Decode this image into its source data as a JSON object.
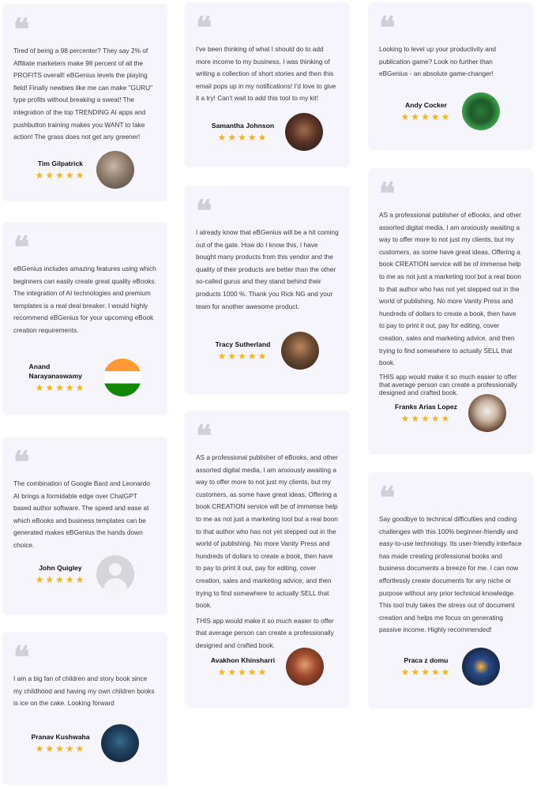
{
  "testimonials": [
    {
      "text": [
        "Tired of being a 98 percenter? They say 2% of Affiliate marketers make 98 percent of all the PROFITS overall! eBGenius levels the playing field! Finally newbies like me can make \"GURU\" type profits without breaking a sweat! The integration of the top TRENDING AI apps and pushbutton training makes you WANT to take action! The grass does not get any greener!"
      ],
      "name": "Tim Gilpatrick",
      "stars": "★★★★★"
    },
    {
      "text": [
        "eBGenius includes amazing features using which beginners can easily create great quality eBooks. The integration of AI technologies and premium templates is a real deal breaker. I would highly recommend eBGenius for your upcoming eBook creation requirements."
      ],
      "name": "Anand Narayanaswamy",
      "stars": "★★★★★"
    },
    {
      "text": [
        "The combination of Google Bard and Leonardo AI brings a formidable edge over ChatGPT based author software. The speed and ease at which eBooks and business templates can be generated makes eBGenius the hands down choice."
      ],
      "name": "John Quigley",
      "stars": "★★★★★"
    },
    {
      "text": [
        "I am a big fan of children and story book since my childhood and having my own children books is ice on the cake. Looking forward"
      ],
      "name": "Pranav Kushwaha",
      "stars": "★★★★★"
    },
    {
      "text": [
        "I've been thinking of what I should do to add more income to my business. I was thinking of writing a collection of short stories and then this email pops up in my notifications! I'd love to give it a try! Can't wait to add this tool to my kit!"
      ],
      "name": "Samantha Johnson",
      "stars": "★★★★★"
    },
    {
      "text": [
        "I already know that eBGenius will be a hit coming out of the gate. How do I know this, I have bought many products from this vendor and the quality of their products are better than the other so-called gurus and they stand behind their products 1000 %. Thank you Rick NG and your team for another awesome product."
      ],
      "name": "Tracy Sutherland",
      "stars": "★★★★★"
    },
    {
      "text": [
        "AS a professional publisher of eBooks, and other assorted digital media, I am anxiously awaiting a way to offer more to not just my clients, but my customers, as some have great ideas, Offering a book CREATION service will be of immense help to me as not just a marketing tool but a real boon to that author who has not yet stepped out in the world of publishing. No more Vanity Press and hundreds of dollars to create a book, then have to pay to print it out, pay for editing, cover creation, sales and marketing advice, and then trying to find somewhere to actually SELL that book.",
        "THIS app would make it so much easier to offer that average person can create a professionally designed and crafted book."
      ],
      "name": "Avakhon Khinsharri",
      "stars": "★★★★★"
    },
    {
      "text": [
        "Looking to level up your productivity and publication game? Look no further than eBGenius - an absolute game-changer!"
      ],
      "name": "Andy Cocker",
      "stars": "★★★★★"
    },
    {
      "text": [
        "AS a professional publisher of eBooks, and other assorted digital media, I am anxiously awaiting a way to offer more to not just my clients, but my customers, as some have great ideas, Offering a book CREATION service will be of immense help to me as not just a marketing tool but a real boon to that author who has not yet stepped out in the world of publishing. No more Vanity Press and hundreds of dollars to create a book, then have to pay to print it out, pay for editing, cover creation, sales and marketing advice, and then trying to find somewhere to actually SELL that book.",
        "THIS app would make it so much easier to offer that average person can create a professionally designed and crafted book."
      ],
      "name": "Franks Arias Lopez",
      "stars": "★★★★★"
    },
    {
      "text": [
        "Say goodbye to technical difficulties and coding challenges with this 100% beginner-friendly and easy-to-use technology. Its user-friendly interface has made creating professional books and business documents a breeze for me. I can now effortlessly create documents for any niche or purpose without any prior technical knowledge. This tool truly takes the stress out of document creation and helps me focus on generating passive income. Highly recommended!"
      ],
      "name": "Praca z domu",
      "stars": "★★★★★"
    }
  ]
}
